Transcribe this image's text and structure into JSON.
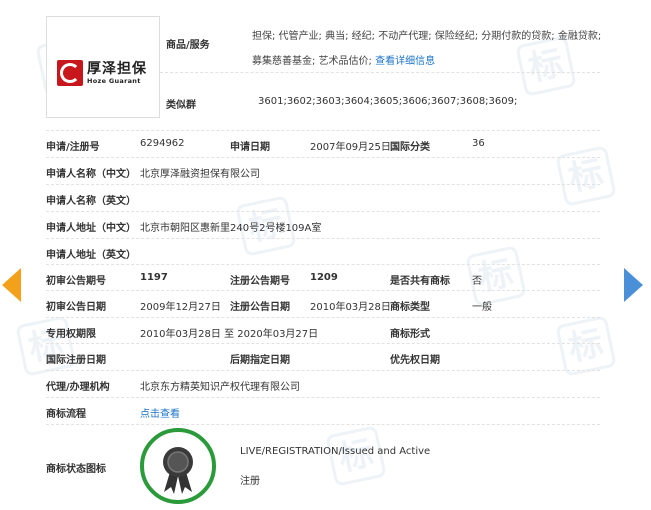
{
  "logo": {
    "cn": "厚泽担保",
    "en": "Hoze Guarant"
  },
  "goods": {
    "label": "商品/服务",
    "text": "担保; 代管产业; 典当; 经纪; 不动产代理; 保险经纪; 分期付款的贷款; 金融贷款; 募集慈善基金; 艺术品估价;",
    "link": "查看详细信息"
  },
  "group": {
    "label": "类似群",
    "value": "3601;3602;3603;3604;3605;3606;3607;3608;3609;"
  },
  "rows": {
    "reg_no": {
      "label": "申请/注册号",
      "value": "6294962"
    },
    "apply_date": {
      "label": "申请日期",
      "value": "2007年09月25日"
    },
    "intl_class": {
      "label": "国际分类",
      "value": "36"
    },
    "applicant_cn": {
      "label": "申请人名称（中文）",
      "value": "北京厚泽融资担保有限公司"
    },
    "applicant_en": {
      "label": "申请人名称（英文）",
      "value": ""
    },
    "address_cn": {
      "label": "申请人地址（中文）",
      "value": "北京市朝阳区惠新里240号2号楼109A室"
    },
    "address_en": {
      "label": "申请人地址（英文）",
      "value": ""
    },
    "prelim_no": {
      "label": "初审公告期号",
      "value": "1197"
    },
    "reg_pub_no": {
      "label": "注册公告期号",
      "value": "1209"
    },
    "shared": {
      "label": "是否共有商标",
      "value": "否"
    },
    "prelim_date": {
      "label": "初审公告日期",
      "value": "2009年12月27日"
    },
    "reg_pub_date": {
      "label": "注册公告日期",
      "value": "2010年03月28日"
    },
    "tm_type": {
      "label": "商标类型",
      "value": "一般"
    },
    "excl_period": {
      "label": "专用权期限",
      "value": "2010年03月28日 至 2020年03月27日"
    },
    "tm_form": {
      "label": "商标形式",
      "value": ""
    },
    "intl_reg_date": {
      "label": "国际注册日期",
      "value": ""
    },
    "later_date": {
      "label": "后期指定日期",
      "value": ""
    },
    "priority_date": {
      "label": "优先权日期",
      "value": ""
    },
    "agent": {
      "label": "代理/办理机构",
      "value": "北京东方精英知识产权代理有限公司"
    },
    "flow": {
      "label": "商标流程",
      "value": "点击查看"
    },
    "status_icon": {
      "label": "商标状态图标",
      "status_en": "LIVE/REGISTRATION/Issued and Active",
      "status_cn": "注册"
    }
  },
  "watermark_char": "标",
  "colors": {
    "accent_link": "#1a73c8",
    "badge_green": "#2a9a3a",
    "arrow_left": "#f3a11b",
    "arrow_right": "#4a90d9",
    "logo_red": "#c8161d"
  },
  "icons": {
    "prev": "arrow-left-icon",
    "next": "arrow-right-icon",
    "status": "seal-ribbon-icon"
  }
}
